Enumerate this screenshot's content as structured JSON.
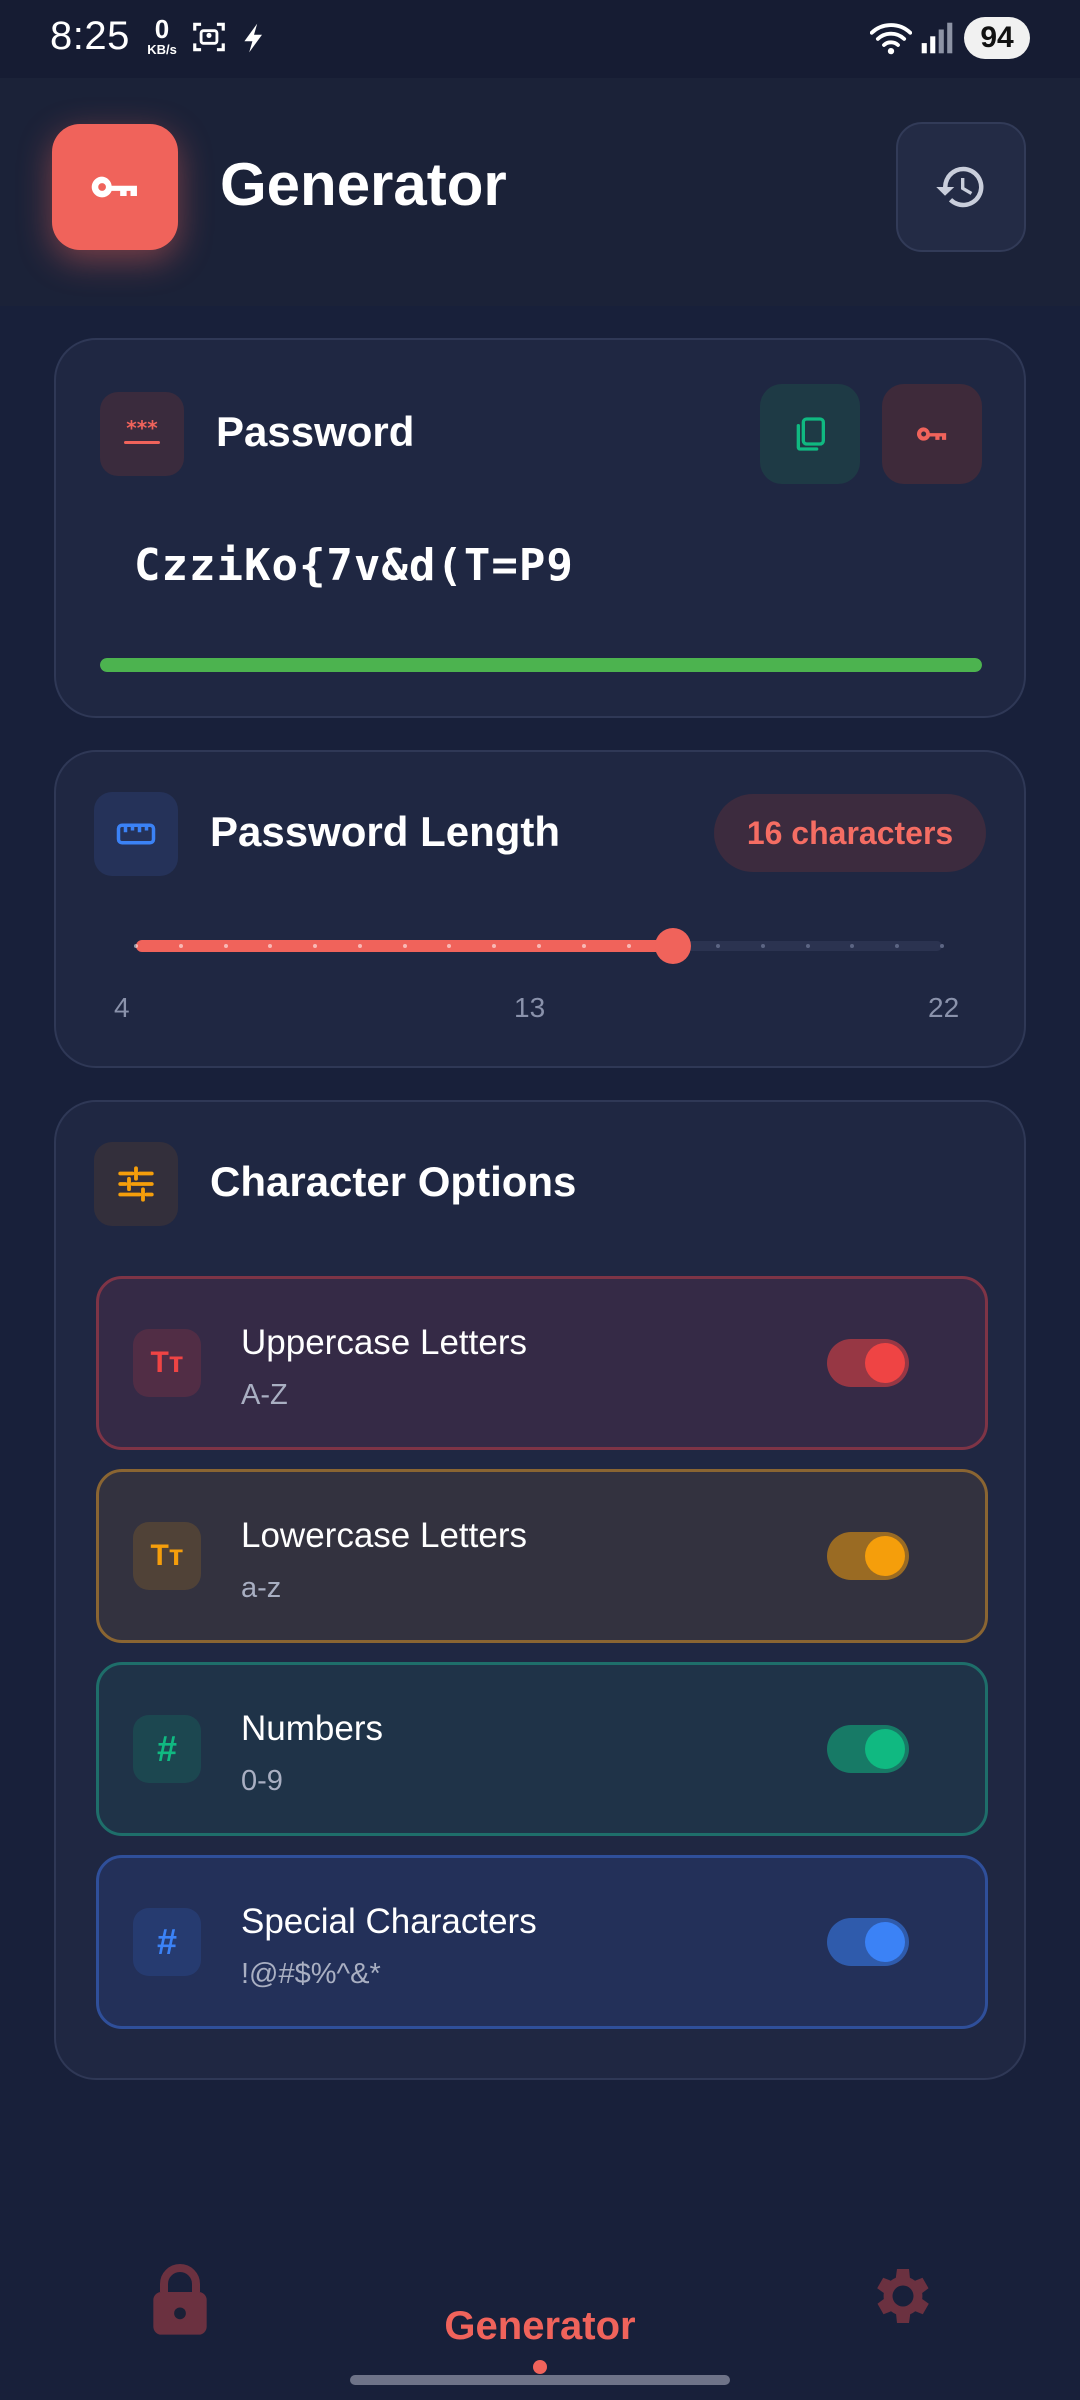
{
  "status_bar": {
    "time": "8:25",
    "net_speed_value": "0",
    "net_speed_unit": "KB/s",
    "battery": "94"
  },
  "header": {
    "title": "Generator",
    "logo_icon": "key-icon",
    "history_icon": "history-icon"
  },
  "password_card": {
    "title": "Password",
    "icon": "password-dots-icon",
    "value": "CzziKo{7v&d(T=P9",
    "copy_icon": "copy-icon",
    "regenerate_icon": "key-icon",
    "strength_fraction": 1.0,
    "strength_color": "#4cb34f"
  },
  "length_card": {
    "title": "Password Length",
    "icon": "ruler-icon",
    "badge": "16 characters",
    "value": 16,
    "min_label": "4",
    "mid_label": "13",
    "max_label": "22",
    "min": 4,
    "max": 22
  },
  "options_card": {
    "title": "Character Options",
    "icon": "sliders-icon",
    "options": [
      {
        "title": "Uppercase Letters",
        "subtitle": "A-Z",
        "icon": "text-case-icon",
        "glyph": "Tт",
        "enabled": true,
        "color": "#ef4444",
        "bg": "#352a46",
        "border": "#7e3446"
      },
      {
        "title": "Lowercase Letters",
        "subtitle": "a-z",
        "icon": "text-case-icon",
        "glyph": "Tт",
        "enabled": true,
        "color": "#f59e0b",
        "bg": "#33323f",
        "border": "#8a6532"
      },
      {
        "title": "Numbers",
        "subtitle": "0-9",
        "icon": "hash-icon",
        "glyph": "#",
        "enabled": true,
        "color": "#10b981",
        "bg": "#1f3348",
        "border": "#1e6e6a"
      },
      {
        "title": "Special Characters",
        "subtitle": "!@#$%^&*",
        "icon": "hash-icon",
        "glyph": "#",
        "enabled": true,
        "color": "#3b82f6",
        "bg": "#233059",
        "border": "#2f4f9a"
      }
    ]
  },
  "bottom_nav": {
    "active_label": "Generator",
    "left_icon": "lock-icon",
    "right_icon": "gear-icon",
    "accent": "#f0635b"
  }
}
